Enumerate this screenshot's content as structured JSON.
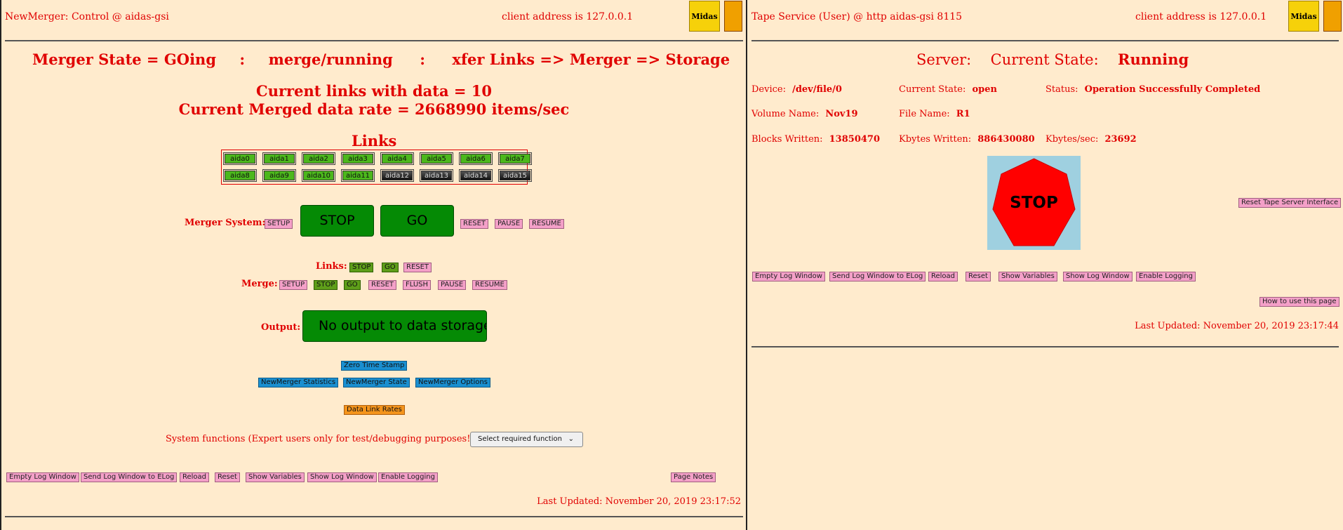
{
  "left": {
    "title": "NewMerger: Control @ aidas-gsi",
    "client_address": "client address is 127.0.0.1",
    "state_line": {
      "state": "Merger State = GOing",
      "sep1": ":",
      "mode": "merge/running",
      "sep2": ":",
      "flow": "xfer Links => Merger => Storage"
    },
    "links_with_data": "Current links with data = 10",
    "merged_rate": "Current Merged data rate = 2668990 items/sec",
    "links_heading": "Links",
    "links_row1": [
      "aida0",
      "aida1",
      "aida2",
      "aida3",
      "aida4",
      "aida5",
      "aida6",
      "aida7"
    ],
    "links_row2": [
      "aida8",
      "aida9",
      "aida10",
      "aida11",
      "aida12",
      "aida13",
      "aida14",
      "aida15"
    ],
    "merger_system": {
      "label": "Merger System:",
      "setup": "SETUP",
      "stop": "STOP",
      "go": "GO",
      "reset": "RESET",
      "pause": "PAUSE",
      "resume": "RESUME"
    },
    "links_ctrl": {
      "label": "Links:",
      "stop": "STOP",
      "go": "GO",
      "reset": "RESET"
    },
    "merge_ctrl": {
      "label": "Merge:",
      "setup": "SETUP",
      "stop": "STOP",
      "go": "GO",
      "reset": "RESET",
      "flush": "FLUSH",
      "pause": "PAUSE",
      "resume": "RESUME"
    },
    "output": {
      "label": "Output:",
      "button": "No output to data storage"
    },
    "zero_time_stamp": "Zero Time Stamp",
    "stats": "NewMerger Statistics",
    "state": "NewMerger State",
    "options": "NewMerger Options",
    "data_link_rates": "Data Link Rates",
    "system_functions": "System functions (Expert users only for test/debugging purposes!!!)",
    "select_function": "Select required function",
    "bottom": {
      "empty_log": "Empty Log Window",
      "send_log": "Send Log Window to ELog",
      "reload": "Reload",
      "reset": "Reset",
      "show_vars": "Show Variables",
      "show_log": "Show Log Window",
      "enable_logging": "Enable Logging",
      "page_notes": "Page Notes"
    },
    "last_updated": "Last Updated: November 20, 2019 23:17:52"
  },
  "right": {
    "title": "Tape Service (User) @ http aidas-gsi 8115",
    "client_address": "client address is 127.0.0.1",
    "server_label": "Server:",
    "current_state_label": "Current State:",
    "current_state_value": "Running",
    "device_label": "Device:",
    "device_value": "/dev/file/0",
    "cs_label": "Current State:",
    "cs_value": "open",
    "status_label": "Status:",
    "status_value": "Operation Successfully Completed",
    "volume_label": "Volume Name:",
    "volume_value": "Nov19",
    "file_label": "File Name:",
    "file_value": "R1",
    "blocks_label": "Blocks Written:",
    "blocks_value": "13850470",
    "kbytes_label": "Kbytes Written:",
    "kbytes_value": "886430080",
    "kbps_label": "Kbytes/sec:",
    "kbps_value": "23692",
    "stop_sign": "STOP",
    "reset_interface": "Reset Tape Server Interface",
    "bottom": {
      "empty_log": "Empty Log Window",
      "send_log": "Send Log Window to ELog",
      "reload": "Reload",
      "reset": "Reset",
      "show_vars": "Show Variables",
      "show_log": "Show Log Window",
      "enable_logging": "Enable Logging"
    },
    "how_to": "How to use this page",
    "last_updated": "Last Updated: November 20, 2019 23:17:44"
  },
  "logo_text": "Midas",
  "colors": {
    "background": "#ffebcd",
    "text": "#e00000",
    "link_active": "#4cb81c",
    "link_inactive": "#222222",
    "stop_sign": "#ff0000",
    "stop_bg": "#9fd0e0"
  }
}
